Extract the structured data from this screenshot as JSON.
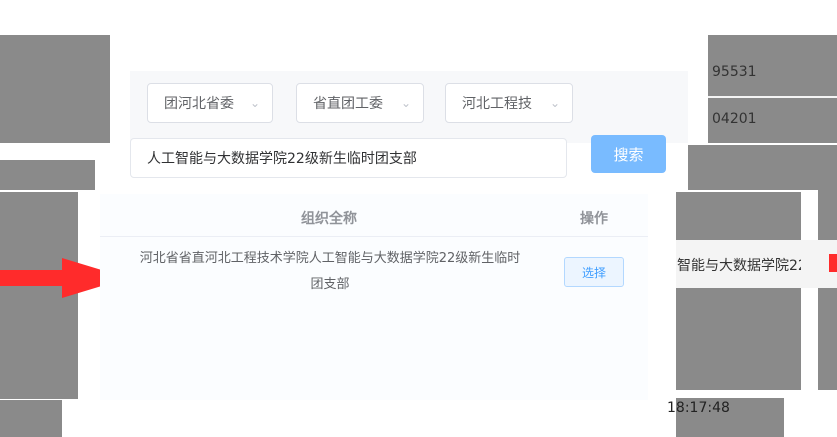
{
  "background": {
    "cell_texts": [
      "95531",
      "04201",
      "智能与大数据学院22",
      "18:17:48"
    ],
    "arrow_color": "#ff2b2b"
  },
  "dialog": {
    "filters": {
      "province": "团河北省委",
      "department": "省直团工委",
      "school": "河北工程技"
    },
    "search": {
      "value": "人工智能与大数据学院22级新生临时团支部",
      "button_label": "搜索"
    },
    "table": {
      "headers": [
        "组织全称",
        "操作"
      ],
      "rows": [
        {
          "full_name_line1": "河北省省直河北工程技术学院人工智能与大数据学院22级新生临时",
          "full_name_line2": "团支部",
          "action_label": "选择"
        }
      ]
    },
    "colors": {
      "primary": "#409eff",
      "search_button": "#79bbff"
    }
  }
}
